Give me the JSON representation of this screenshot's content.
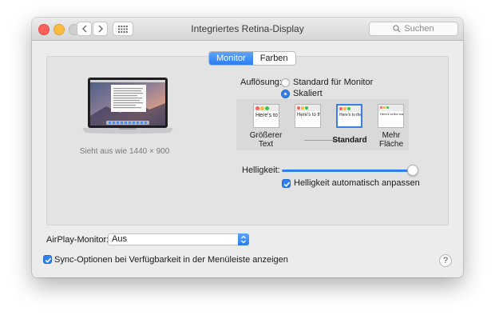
{
  "window": {
    "title": "Integriertes Retina-Display"
  },
  "toolbar": {
    "search_placeholder": "Suchen"
  },
  "tabs": [
    {
      "label": "Monitor",
      "selected": true
    },
    {
      "label": "Farben",
      "selected": false
    }
  ],
  "display": {
    "looks_like": "Sieht aus wie 1440 × 900"
  },
  "resolution": {
    "label": "Auflösung:",
    "options": [
      {
        "label": "Standard für Monitor",
        "selected": false
      },
      {
        "label": "Skaliert",
        "selected": true
      }
    ],
    "thumb_text": "Here's to the crazy ones. The misfits. The rebels. The troublemakers. The ones who see things differently. And they",
    "scales": [
      {
        "label_line1": "Größerer",
        "label_line2": "Text",
        "selected": false
      },
      {
        "label_line1": "",
        "label_line2": "",
        "selected": false
      },
      {
        "label_line1": "Standard",
        "label_line2": "",
        "selected": true
      },
      {
        "label_line1": "Mehr",
        "label_line2": "Fläche",
        "selected": false
      }
    ]
  },
  "brightness": {
    "label": "Helligkeit:",
    "level": 1.0,
    "auto_label": "Helligkeit automatisch anpassen",
    "auto_checked": true
  },
  "airplay": {
    "label": "AirPlay-Monitor:",
    "value": "Aus"
  },
  "sync": {
    "label": "Sync-Optionen bei Verfügbarkeit in der Menüleiste anzeigen",
    "checked": true
  },
  "help": {
    "symbol": "?"
  },
  "colors": {
    "accent": "#2f80f0",
    "close": "#fc605b",
    "minimize": "#fdbc40",
    "zoom": "#d0d0d0"
  },
  "icons": [
    "chevron-left-icon",
    "chevron-right-icon",
    "grid-icon",
    "search-icon",
    "checkmark-icon",
    "updown-arrows-icon"
  ]
}
